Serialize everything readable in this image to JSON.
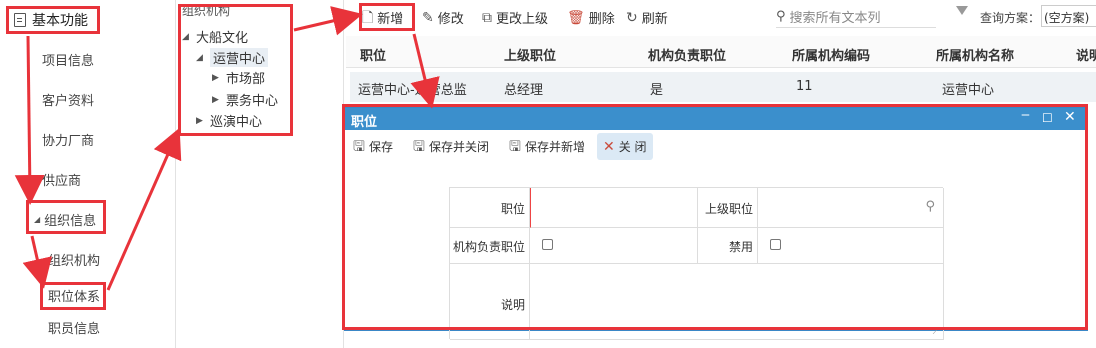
{
  "left_menu": {
    "top_label": "基本功能",
    "items": [
      "项目信息",
      "客户资料",
      "协力厂商",
      "供应商"
    ],
    "group_label": "组织信息",
    "sub_items": [
      "组织机构",
      "职位体系",
      "职员信息"
    ]
  },
  "tree": {
    "header": "组织机构",
    "nodes": [
      "大船文化",
      "运营中心",
      "市场部",
      "票务中心",
      "巡演中心"
    ]
  },
  "toolbar": {
    "add": "新增",
    "edit": "修改",
    "change_parent": "更改上级",
    "delete": "删除",
    "refresh": "刷新",
    "search_placeholder": "搜索所有文本列",
    "query_label": "查询方案：",
    "query_value": "(空方案)"
  },
  "grid": {
    "columns": [
      "职位",
      "上级职位",
      "机构负责职位",
      "所属机构编码",
      "所属机构名称",
      "说明"
    ],
    "row": [
      "运营中心-运营总监",
      "总经理",
      "是",
      "11",
      "运营中心"
    ]
  },
  "dialog": {
    "title": "职位",
    "save": "保存",
    "save_close": "保存并关闭",
    "save_new": "保存并新增",
    "close": "关 闭",
    "labels": {
      "position": "职位",
      "parent": "上级职位",
      "head": "机构负责职位",
      "disabled": "禁用",
      "desc": "说明"
    }
  },
  "colors": {
    "annotation": "#e8333a",
    "dialog_title": "#3b8fcc"
  }
}
